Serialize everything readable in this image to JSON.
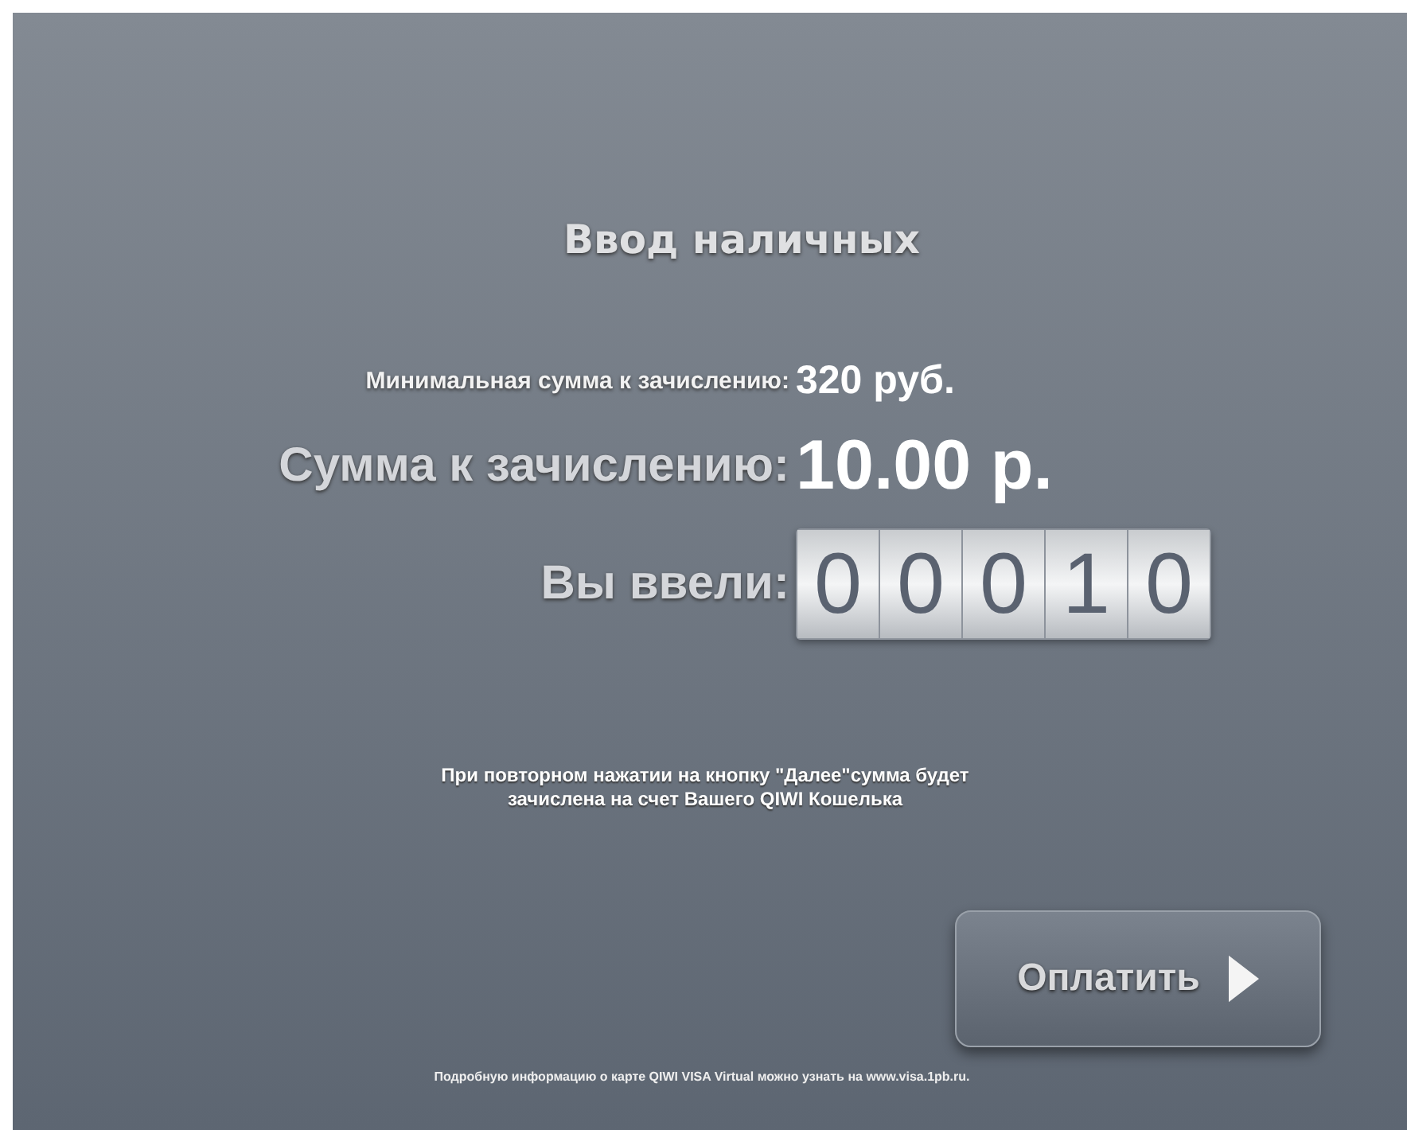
{
  "title": "Ввод наличных",
  "rows": [
    {
      "kind": "small",
      "label": "Минимальная сумма к зачислению:",
      "value": "320 руб."
    },
    {
      "kind": "large",
      "label": "Сумма к зачислению:",
      "value": "10.00 р."
    },
    {
      "kind": "counter",
      "label": "Вы ввели:",
      "digits": [
        "0",
        "0",
        "0",
        "1",
        "0"
      ]
    }
  ],
  "note": "При повторном нажатии на кнопку \"Далее\"сумма будет\nзачислена на счет Вашего QIWI Кошелька",
  "pay_button": {
    "label": "Оплатить"
  },
  "footer": "Подробную информацию о карте QIWI VISA Virtual можно узнать на www.visa.1pb.ru."
}
